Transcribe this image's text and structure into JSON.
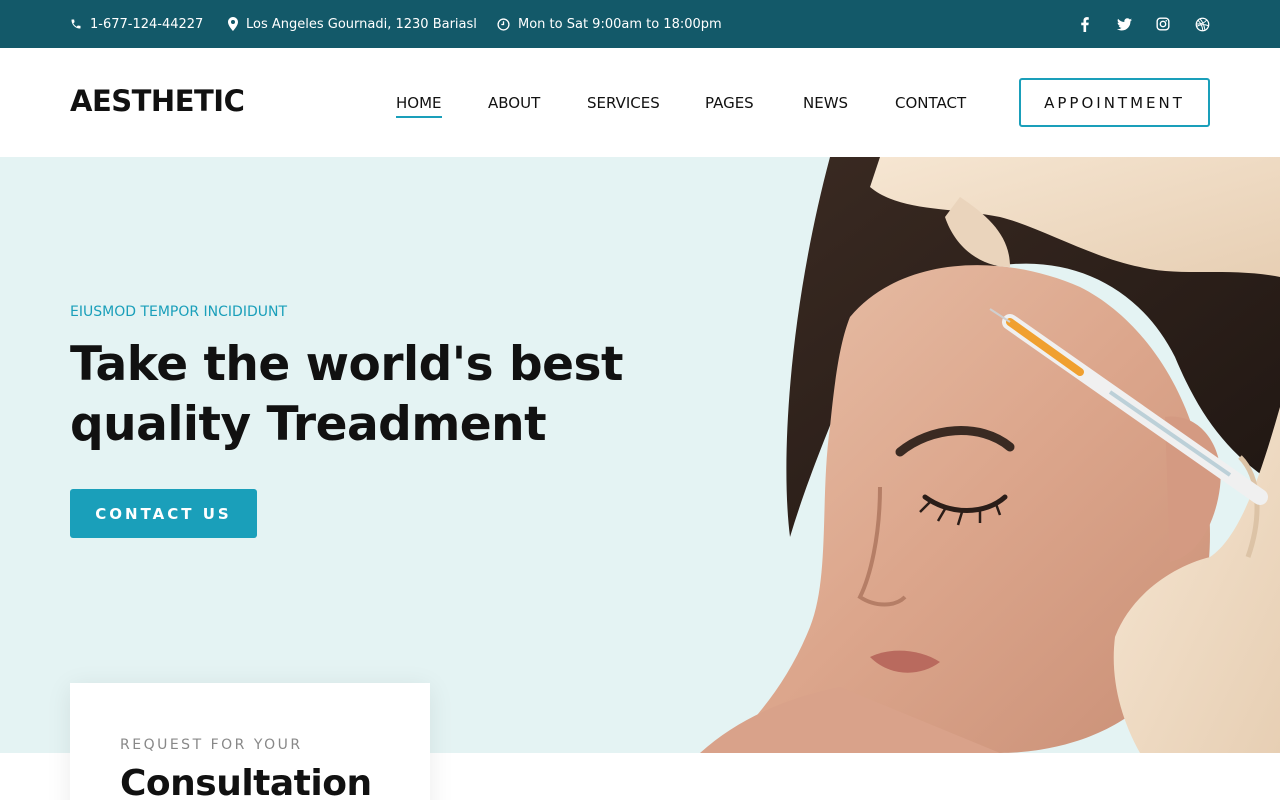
{
  "topbar": {
    "phone": "1-677-124-44227",
    "address": "Los Angeles Gournadi, 1230 Bariasl",
    "hours": "Mon to Sat 9:00am to 18:00pm",
    "socials": [
      "facebook-icon",
      "twitter-icon",
      "instagram-icon",
      "dribbble-icon"
    ]
  },
  "header": {
    "logo": "AESTHETIC",
    "nav": [
      {
        "label": "HOME",
        "active": true
      },
      {
        "label": "ABOUT",
        "active": false
      },
      {
        "label": "SERVICES",
        "active": false
      },
      {
        "label": "PAGES",
        "active": false
      },
      {
        "label": "NEWS",
        "active": false
      },
      {
        "label": "CONTACT",
        "active": false
      }
    ],
    "appointment_label": "APPOINTMENT"
  },
  "hero": {
    "subtitle": "EIUSMOD TEMPOR INCIDIDUNT",
    "title_line1": "Take the world's best",
    "title_line2": "quality Treadment",
    "cta_label": "CONTACT US"
  },
  "consultation": {
    "kicker": "REQUEST FOR YOUR",
    "title": "Consultation"
  },
  "colors": {
    "topbar_bg": "#135969",
    "accent": "#1a9fba",
    "hero_bg": "#e4f3f3",
    "text_dark": "#111111"
  }
}
